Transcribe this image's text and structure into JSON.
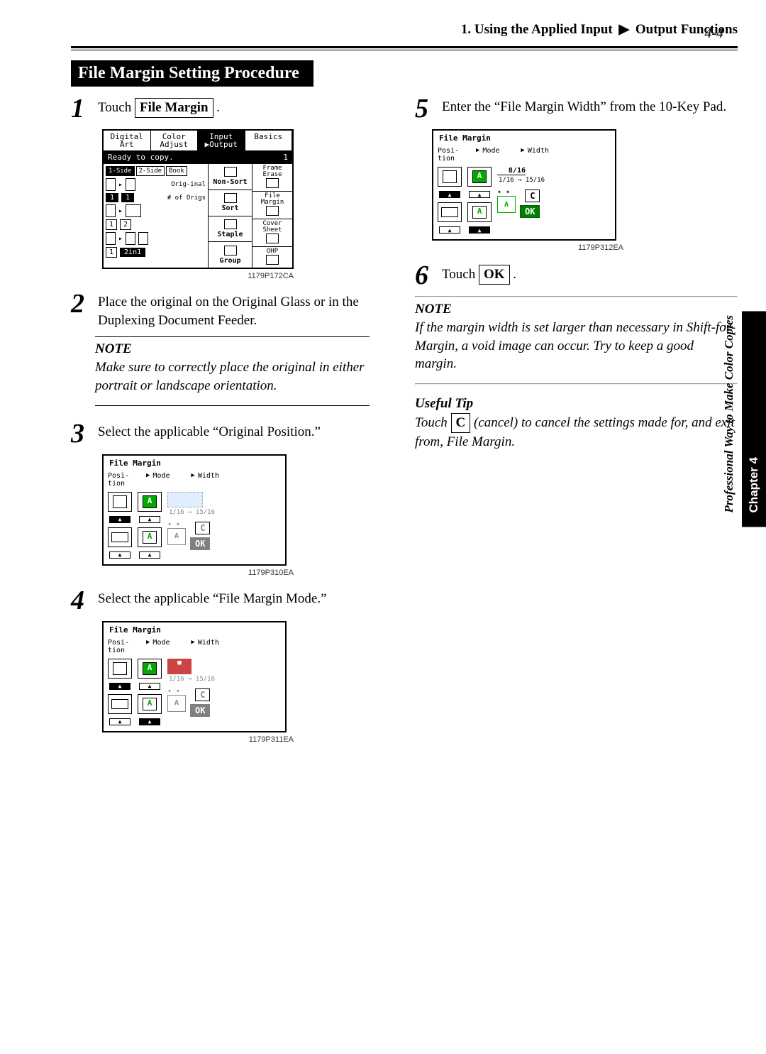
{
  "page_number": "4-4",
  "header": {
    "left": "1. Using the Applied Input",
    "right": "Output Functions"
  },
  "section_title": "File Margin Setting Procedure",
  "sidebar": {
    "chapter": "Chapter 4",
    "subtitle": "Professional Way to Make Color Copies"
  },
  "steps": {
    "s1": {
      "num": "1",
      "pre": "Touch ",
      "box": "File Margin",
      "post": " ."
    },
    "s2": {
      "num": "2",
      "text": "Place the original on the Original Glass or in the Duplexing Document Feeder."
    },
    "s3": {
      "num": "3",
      "text": "Select the applicable “Original Position.”"
    },
    "s4": {
      "num": "4",
      "text": "Select the applicable “File Margin Mode.”"
    },
    "s5": {
      "num": "5",
      "text": "Enter the “File Margin Width” from the 10-Key Pad."
    },
    "s6": {
      "num": "6",
      "pre": "Touch ",
      "box": "OK",
      "post": " ."
    }
  },
  "notes": {
    "n1_head": "NOTE",
    "n1_body": "Make sure to correctly place the original in either portrait or landscape orientation.",
    "n2_head": "NOTE",
    "n2_body": "If the margin width is set larger than necessary in Shift-for-Margin, a void image can occur. Try to keep a good margin."
  },
  "tip": {
    "head": "Useful Tip",
    "pre": "Touch ",
    "box": "C",
    "mid": " (cancel) to cancel the settings made for, and exit from, File Margin."
  },
  "figures": {
    "f1_id": "1179P172CA",
    "f3_id": "1179P310EA",
    "f4_id": "1179P311EA",
    "f5_id": "1179P312EA"
  },
  "copier": {
    "tabs": [
      "Digital Art",
      "Color Adjust",
      "Input ▶Output",
      "Basics"
    ],
    "status": "Ready to copy.",
    "count": "1",
    "left_tabs": [
      "1-Side",
      "2-Side",
      "Book"
    ],
    "orig": "Orig-inal",
    "of": "# of Origs",
    "mid_labels": [
      "Non-Sort",
      "Sort",
      "Staple",
      "Group"
    ],
    "right_labels": [
      "Frame Erase",
      "File Margin",
      "Cover Sheet",
      "OHP"
    ],
    "nums": {
      "a": "1",
      "b": "1",
      "c": "1",
      "d": "2",
      "e": "1",
      "f": "2in1"
    }
  },
  "fm_panel": {
    "title": "File Margin",
    "headers": {
      "pos": "Posi-tion",
      "mode": "Mode",
      "width": "Width"
    },
    "range": "1/16 → 15/16",
    "c": "C",
    "ok": "OK",
    "readout": "8/16"
  }
}
